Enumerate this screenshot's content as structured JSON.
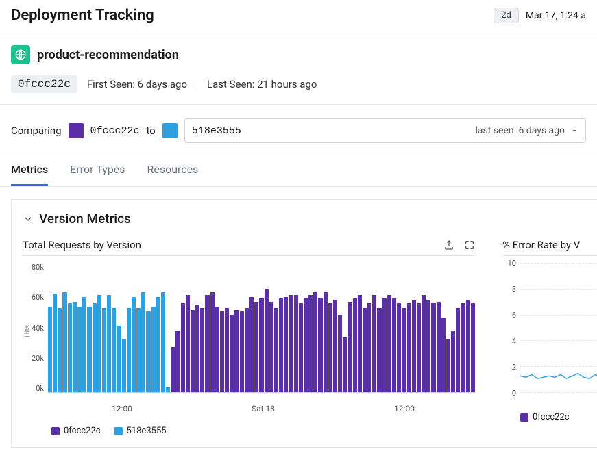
{
  "page_title": "Deployment Tracking",
  "time_range_pill": "2d",
  "time_display": "Mar 17, 1:24 a",
  "service": {
    "name": "product-recommendation",
    "icon_color": "#1cc18e",
    "primary_hash": "0fccc22c",
    "first_seen": "First Seen: 6 days ago",
    "last_seen": "Last Seen: 21 hours ago"
  },
  "compare": {
    "label": "Comparing",
    "from_hash": "0fccc22c",
    "to_label": "to",
    "to_hash": "518e3555",
    "select_meta": "last seen: 6 days ago"
  },
  "tabs": [
    {
      "label": "Metrics",
      "active": true
    },
    {
      "label": "Error Types",
      "active": false
    },
    {
      "label": "Resources",
      "active": false
    }
  ],
  "section_title": "Version Metrics",
  "chart1": {
    "title": "Total Requests by Version",
    "ylabel": "Hits",
    "yticks": [
      "80k",
      "60k",
      "40k",
      "20k",
      "0k"
    ],
    "xticks": [
      "12:00",
      "Sat 18",
      "12:00"
    ],
    "legend": [
      {
        "label": "0fccc22c",
        "color": "#5a2ea6"
      },
      {
        "label": "518e3555",
        "color": "#2ea0df"
      }
    ]
  },
  "chart2": {
    "title": "% Error Rate by V",
    "yticks": [
      "10",
      "8",
      "6",
      "4",
      "2",
      "0"
    ],
    "legend": [
      {
        "label": "0fccc22c",
        "color": "#5a2ea6"
      }
    ]
  },
  "chart_data": [
    {
      "type": "bar",
      "title": "Total Requests by Version",
      "ylabel": "Hits",
      "ylim": [
        0,
        80000
      ],
      "x": "time (2-day window, hourly)",
      "xticks": [
        "12:00",
        "Sat 18",
        "12:00"
      ],
      "series": [
        {
          "name": "518e3555",
          "color": "#2ea0df",
          "values": [
            53000,
            61000,
            52000,
            62000,
            55000,
            56000,
            53000,
            59000,
            53000,
            55000,
            60000,
            52000,
            60000,
            52000,
            41000,
            33000,
            52000,
            59000,
            52000,
            62000,
            50000,
            53000,
            59000,
            62000,
            3000
          ]
        },
        {
          "name": "0fccc22c",
          "color": "#5a2ea6",
          "values": [
            28000,
            38000,
            55000,
            60000,
            51000,
            54000,
            52000,
            60000,
            62000,
            53000,
            50000,
            52000,
            48000,
            51000,
            50000,
            52000,
            59000,
            56000,
            58000,
            64000,
            56000,
            52000,
            58000,
            59000,
            60000,
            60000,
            55000,
            58000,
            60000,
            62000,
            58000,
            62000,
            55000,
            57000,
            48000,
            34000,
            56000,
            58000,
            60000,
            52000,
            55000,
            60000,
            52000,
            58000,
            60000,
            58000,
            55000,
            52000,
            55000,
            57000,
            55000,
            60000,
            57000,
            55000,
            56000,
            46000,
            33000,
            38000,
            52000,
            55000,
            57000,
            55000
          ]
        }
      ]
    },
    {
      "type": "line",
      "title": "% Error Rate by Version (partial)",
      "ylim": [
        0,
        10
      ],
      "series": [
        {
          "name": "0fccc22c",
          "color": "#2ea0df",
          "values": [
            1.4,
            1.3,
            1.5,
            1.2,
            1.3,
            1.4,
            1.3,
            1.5,
            1.2,
            1.4,
            1.6,
            1.3,
            1.2,
            1.5,
            1.3,
            1.7,
            1.4,
            1.3,
            1.6,
            1.5
          ]
        }
      ]
    }
  ]
}
